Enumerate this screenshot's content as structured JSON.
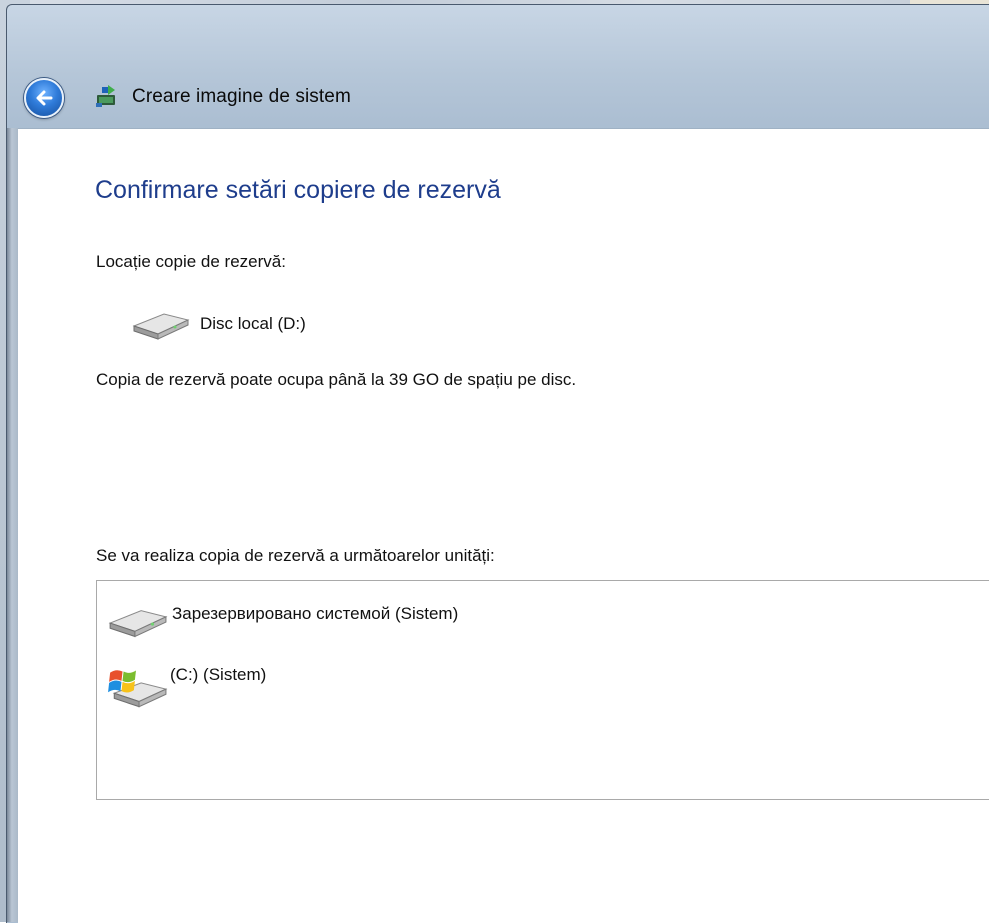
{
  "window": {
    "title": "Creare imagine de sistem"
  },
  "page": {
    "heading": "Confirmare setări copiere de rezervă",
    "location_label": "Locație copie de rezervă:",
    "location_drive": "Disc local (D:)",
    "space_info": "Copia de rezervă poate ocupa până la 39 GO de spațiu pe disc.",
    "drives_label": "Se va realiza copia de rezervă a următoarelor unități:",
    "drives": [
      {
        "name": "Зарезервировано системой (Sistem)",
        "icon": "hard-drive-icon"
      },
      {
        "name": "(C:) (Sistem)",
        "icon": "windows-drive-icon"
      }
    ]
  },
  "colors": {
    "heading": "#1e3d8c",
    "back_button": "#2f7bd9"
  }
}
